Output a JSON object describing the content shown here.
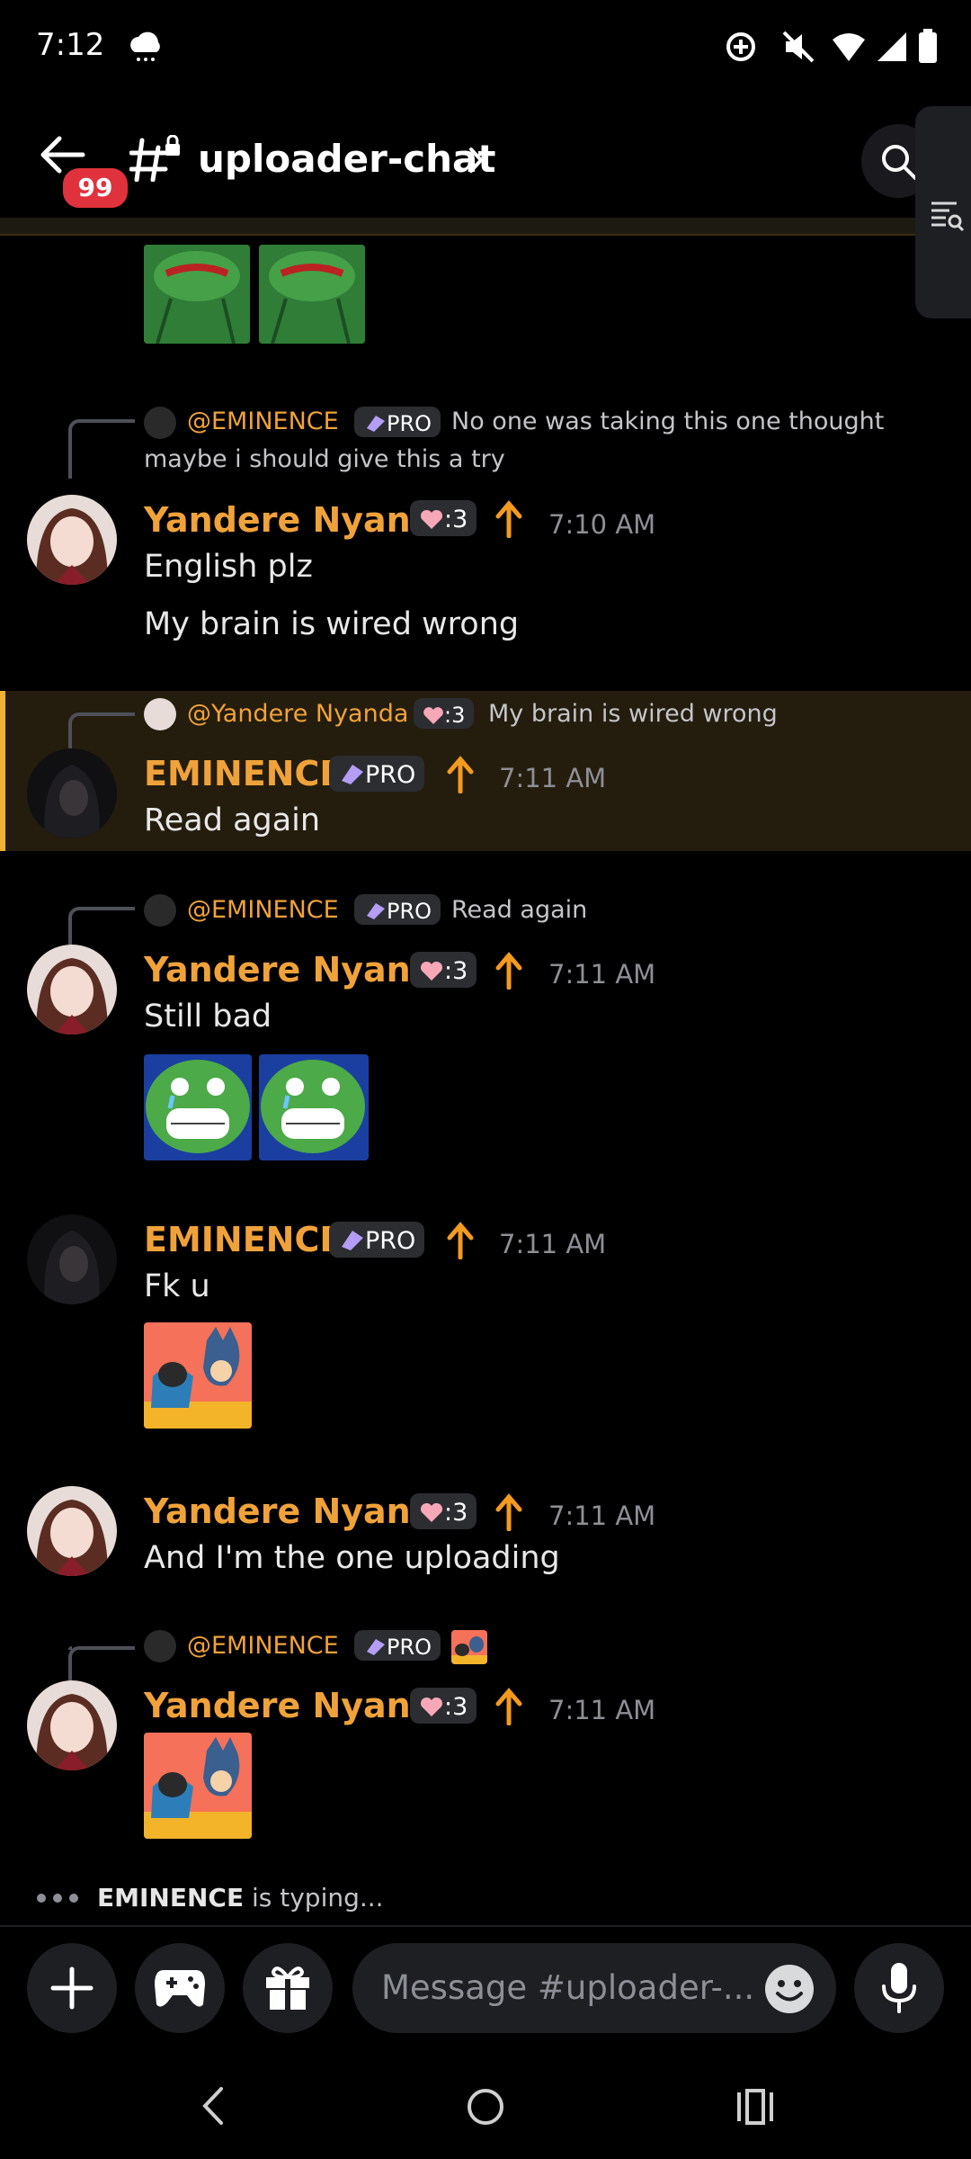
{
  "status_bar": {
    "time": "7:12"
  },
  "header": {
    "notification_count": "99",
    "channel_name": "uploader-chat"
  },
  "messages": [
    {
      "reply_to": {
        "name": "@EMINENCE",
        "badge": "PRO",
        "text": "No one was taking this one thought",
        "text2": "maybe i should give this a try"
      },
      "author": "Yandere Nyanda",
      "badge": ":3",
      "time": "7:10 AM",
      "lines": [
        "English plz",
        "My brain is wired wrong"
      ]
    },
    {
      "reply_to": {
        "name": "@Yandere Nyanda",
        "badge": ":3",
        "text": "My brain is wired wrong"
      },
      "author": "EMINENCE",
      "badge": "PRO",
      "time": "7:11 AM",
      "lines": [
        "Read again"
      ]
    },
    {
      "reply_to": {
        "name": "@EMINENCE",
        "badge": "PRO",
        "text": "Read again"
      },
      "author": "Yandere Nyanda",
      "badge": ":3",
      "time": "7:11 AM",
      "lines": [
        "Still bad"
      ]
    },
    {
      "author": "EMINENCE",
      "badge": "PRO",
      "time": "7:11 AM",
      "lines": [
        "Fk u"
      ]
    },
    {
      "author": "Yandere Nyanda",
      "badge": ":3",
      "time": "7:11 AM",
      "lines": [
        "And I'm the one uploading"
      ]
    },
    {
      "reply_to": {
        "name": "@EMINENCE",
        "badge": "PRO"
      },
      "author": "Yandere Nyanda",
      "badge": ":3",
      "time": "7:11 AM",
      "lines": []
    }
  ],
  "typing": {
    "user": "EMINENCE",
    "text": " is typing..."
  },
  "composer": {
    "placeholder": "Message #uploader-..."
  },
  "colors": {
    "accent": "#f0a23a",
    "highlight": "#f0b232",
    "badge": "#e0323d"
  }
}
